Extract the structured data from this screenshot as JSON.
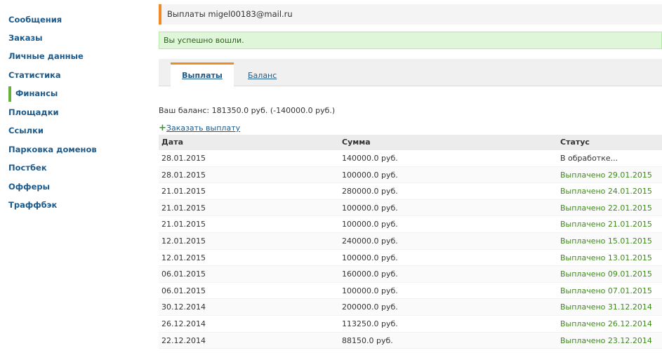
{
  "sidebar": {
    "items": [
      {
        "label": "Сообщения"
      },
      {
        "label": "Заказы"
      },
      {
        "label": "Личные данные"
      },
      {
        "label": "Статистика"
      },
      {
        "label": "Финансы"
      },
      {
        "label": "Площадки"
      },
      {
        "label": "Ссылки"
      },
      {
        "label": "Парковка доменов"
      },
      {
        "label": "Постбек"
      },
      {
        "label": "Офферы"
      },
      {
        "label": "Траффбэк"
      }
    ],
    "active_label": "Финансы"
  },
  "header": {
    "title": "Выплаты migel00183@mail.ru"
  },
  "alert": {
    "message": "Вы успешно вошли."
  },
  "tabs": [
    {
      "label": "Выплаты",
      "active": true
    },
    {
      "label": "Баланс",
      "active": false
    }
  ],
  "balance_text": "Ваш баланс: 181350.0 руб. (-140000.0 руб.)",
  "order_payout": {
    "icon": "plus-icon",
    "label": "Заказать выплату"
  },
  "table": {
    "headers": {
      "date": "Дата",
      "sum": "Сумма",
      "status": "Статус"
    },
    "rows": [
      {
        "date": "28.01.2015",
        "sum": "140000.0 руб.",
        "status": "В обработке..."
      },
      {
        "date": "28.01.2015",
        "sum": "100000.0 руб.",
        "status": "Выплачено 29.01.2015"
      },
      {
        "date": "21.01.2015",
        "sum": "280000.0 руб.",
        "status": "Выплачено 24.01.2015"
      },
      {
        "date": "21.01.2015",
        "sum": "100000.0 руб.",
        "status": "Выплачено 22.01.2015"
      },
      {
        "date": "21.01.2015",
        "sum": "100000.0 руб.",
        "status": "Выплачено 21.01.2015"
      },
      {
        "date": "12.01.2015",
        "sum": "240000.0 руб.",
        "status": "Выплачено 15.01.2015"
      },
      {
        "date": "12.01.2015",
        "sum": "100000.0 руб.",
        "status": "Выплачено 13.01.2015"
      },
      {
        "date": "06.01.2015",
        "sum": "160000.0 руб.",
        "status": "Выплачено 09.01.2015"
      },
      {
        "date": "06.01.2015",
        "sum": "100000.0 руб.",
        "status": "Выплачено 07.01.2015"
      },
      {
        "date": "30.12.2014",
        "sum": "200000.0 руб.",
        "status": "Выплачено 31.12.2014"
      },
      {
        "date": "26.12.2014",
        "sum": "113250.0 руб.",
        "status": "Выплачено 26.12.2014"
      },
      {
        "date": "22.12.2014",
        "sum": "88150.0 руб.",
        "status": "Выплачено 23.12.2014"
      }
    ]
  },
  "colors": {
    "accent_orange": "#f08a24",
    "active_green": "#67b13a",
    "link_blue": "#1d5a8a",
    "paid_green": "#3f8a1c"
  }
}
